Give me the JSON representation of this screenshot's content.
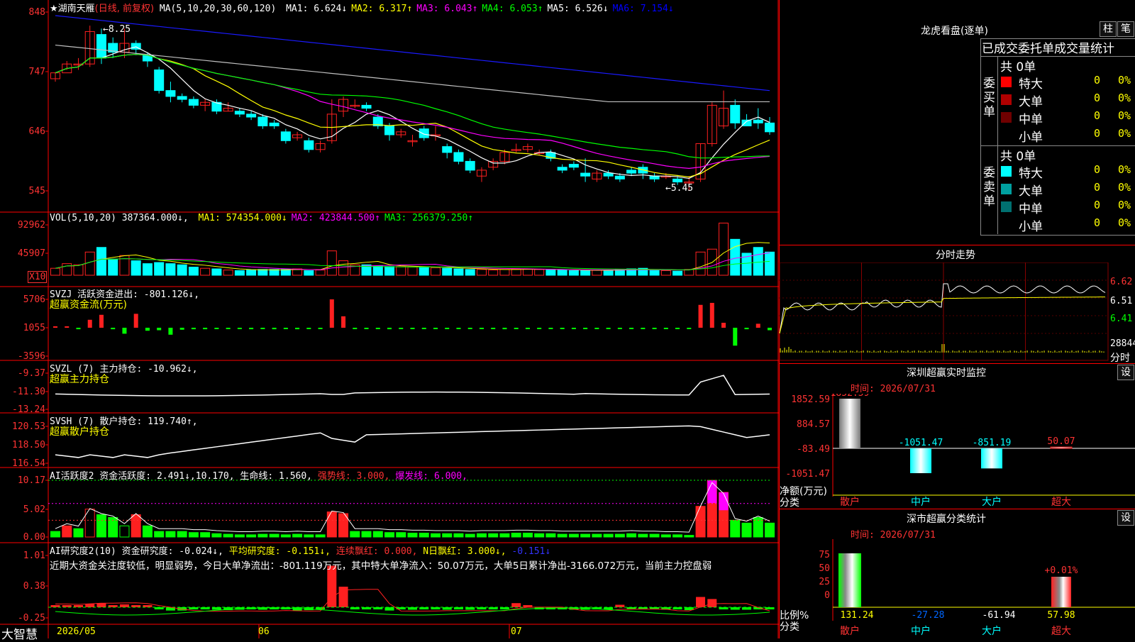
{
  "stock": {
    "name": "★湖南天雁",
    "period": "(日线, 前复权)"
  },
  "k_panel": {
    "ma_header": "MA(5,10,20,30,60,120)",
    "ma": [
      {
        "label": "MA1:",
        "value": "6.624↓",
        "color": "#ffffff"
      },
      {
        "label": "MA2:",
        "value": "6.317↑",
        "color": "#ffff00"
      },
      {
        "label": "MA3:",
        "value": "6.043↑",
        "color": "#ff00ff"
      },
      {
        "label": "MA4:",
        "value": "6.053↑",
        "color": "#00ff00"
      },
      {
        "label": "MA5:",
        "value": "6.526↓",
        "color": "#c0c0c0"
      },
      {
        "label": "MA6:",
        "value": "7.154↓",
        "color": "#0000ff"
      }
    ],
    "y_ticks": [
      "848",
      "747",
      "646",
      "545"
    ],
    "high_marker": "←8.25",
    "low_marker": "←5.45"
  },
  "vol_panel": {
    "header": "VOL(5,10,20)",
    "value": "387364.000↓",
    "ma": [
      {
        "label": "MA1:",
        "value": "574354.000↓",
        "color": "#ffff00"
      },
      {
        "label": "MA2:",
        "value": "423844.500↑",
        "color": "#ff00ff"
      },
      {
        "label": "MA3:",
        "value": "256379.250↑",
        "color": "#00ff00"
      }
    ],
    "y_ticks": [
      "92962",
      "45907"
    ],
    "unit": "X10"
  },
  "svzj_panel": {
    "header": "SVZJ  活跃资金进出:",
    "value": "-801.126↓,",
    "subtitle": "超赢资金流(万元)",
    "y_ticks": [
      "5706",
      "1055",
      "-3596"
    ]
  },
  "svzl_panel": {
    "header": "SVZL (7) 主力持仓:",
    "value": "-10.962↓,",
    "subtitle": "超赢主力持仓",
    "y_ticks": [
      "-9.37",
      "-11.30",
      "-13.24"
    ]
  },
  "svsh_panel": {
    "header": "SVSH (7) 散户持仓:",
    "value": "119.740↑,",
    "subtitle": "超赢散户持仓",
    "y_ticks": [
      "120.53",
      "118.50",
      "116.54"
    ]
  },
  "ai_panel": {
    "header": "AI活跃度2 资金活跃度:",
    "value1": "2.491↓,",
    "value2": "10.170,",
    "life_label": "生命线:",
    "life_value": "1.560,",
    "strong": "强势线: 3.000,",
    "burst": "爆发线: 6.000,",
    "y_ticks": [
      "10.17",
      "5.02",
      "0.00"
    ]
  },
  "research_panel": {
    "header": "AI研究度2(10) 资金研究度:",
    "v1": "-0.024↓,",
    "avg": "平均研究度: -0.151↓,",
    "red": "连续飘红: 0.000,",
    "nred": "N日飘红: 3.000↓,",
    "last": "-0.151↓",
    "note": "近期大资金关注度较低，明显弱势，今日大单净流出：-801.119万元，其中特大单净流入：50.07万元，大单5日累计净出-3166.072万元，当前主力控盘弱",
    "y_ticks": [
      "1.01",
      "0.38",
      "-0.25"
    ]
  },
  "x_axis": {
    "brand": "大智慧",
    "labels": [
      "2026/05",
      "06",
      "07"
    ]
  },
  "longhu": {
    "title": "龙虎看盘(逐单)",
    "btn_bar": "柱",
    "btn_stroke": "笔",
    "tabs": [
      "已成交",
      "委托单",
      "成交量统计"
    ],
    "buy": {
      "side_label": "委买单",
      "total": "共 0单",
      "rows": [
        {
          "name": "特大",
          "count": "0",
          "pct": "0%",
          "color": "#ff0000"
        },
        {
          "name": "大单",
          "count": "0",
          "pct": "0%",
          "color": "#b00000"
        },
        {
          "name": "中单",
          "count": "0",
          "pct": "0%",
          "color": "#700000"
        },
        {
          "name": "小单",
          "count": "0",
          "pct": "0%",
          "color": ""
        }
      ]
    },
    "sell": {
      "side_label": "委卖单",
      "total": "共 0单",
      "rows": [
        {
          "name": "特大",
          "count": "0",
          "pct": "0%",
          "color": "#00ffff"
        },
        {
          "name": "大单",
          "count": "0",
          "pct": "0%",
          "color": "#00a0a0"
        },
        {
          "name": "中单",
          "count": "0",
          "pct": "0%",
          "color": "#007070"
        },
        {
          "name": "小单",
          "count": "0",
          "pct": "0%",
          "color": ""
        }
      ]
    }
  },
  "intraday": {
    "title": "分时走势",
    "prices": [
      "6.62",
      "6.51",
      "6.41"
    ],
    "volume": "28844",
    "unit": "分时"
  },
  "monitor": {
    "title": "深圳超赢实时监控",
    "settings": "设",
    "time": "时间: 2026/07/31",
    "y_ticks": [
      "1852.59",
      "884.57",
      "-83.49",
      "-1051.47"
    ],
    "y_label": "净额(万元)",
    "x_label": "分类",
    "categories": [
      "散户",
      "中户",
      "大户",
      "超大"
    ],
    "values": [
      "1852.59",
      "-1051.47",
      "-851.19",
      "50.07"
    ]
  },
  "classify": {
    "title": "深市超赢分类统计",
    "settings": "设",
    "time": "时间: 2026/07/31",
    "y_ticks": [
      "75",
      "50",
      "25",
      "0"
    ],
    "y_label": "比例%",
    "x_label": "分类",
    "categories": [
      "散户",
      "中户",
      "大户",
      "超大"
    ],
    "values": [
      "131.24",
      "-27.28",
      "-61.94",
      "57.98"
    ],
    "top_label": "+0.01%"
  },
  "chart_data": {
    "type": "bar",
    "title": "深圳超赢实时监控",
    "ylabel": "净额(万元)",
    "xlabel": "分类",
    "categories": [
      "散户",
      "中户",
      "大户",
      "超大"
    ],
    "values": [
      1852.59,
      -1051.47,
      -851.19,
      50.07
    ],
    "ylim": [
      -1051.47,
      1852.59
    ]
  }
}
